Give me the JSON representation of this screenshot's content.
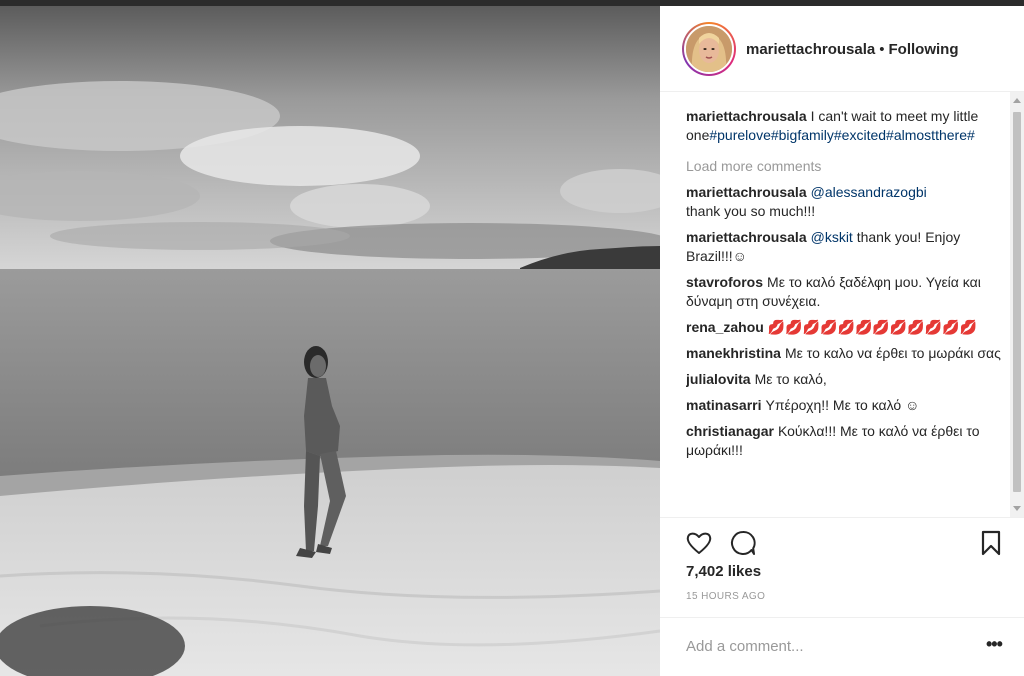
{
  "post": {
    "username": "mariettachrousala",
    "separator": "•",
    "follow_status": "Following",
    "caption": {
      "user": "mariettachrousala",
      "text": "I can't wait to meet my little one",
      "hashtags": [
        "#purelove",
        "#bigfamily",
        "#excited",
        "#almostthere",
        "#"
      ]
    },
    "load_more": "Load more comments",
    "comments": [
      {
        "user": "mariettachrousala",
        "mention": "@alessandrazogbi",
        "text": "thank you so much!!!"
      },
      {
        "user": "mariettachrousala",
        "mention": "@kskit",
        "text": "thank you! Enjoy Brazil!!!☺"
      },
      {
        "user": "stavroforos",
        "mention": "",
        "text": "Με το καλό ξαδέλφη μου. Υγεία και δύναμη στη συνέχεια."
      },
      {
        "user": "rena_zahou",
        "mention": "",
        "text": "💋💋💋💋💋💋💋💋💋💋💋💋"
      },
      {
        "user": "manekhristina",
        "mention": "",
        "text": "Με το καλο να έρθει το μωράκι σας"
      },
      {
        "user": "julialovita",
        "mention": "",
        "text": "Με το καλό,"
      },
      {
        "user": "matinasarri",
        "mention": "",
        "text": "Υπέροχη!! Με το καλό ☺"
      },
      {
        "user": "christianagar",
        "mention": "",
        "text": "Κούκλα!!! Με το καλό να έρθει το μωράκι!!!"
      }
    ],
    "likes": "7,402 likes",
    "time_ago": "15 HOURS AGO",
    "add_comment_placeholder": "Add a comment...",
    "more_options": "•••"
  },
  "icons": {
    "like": "heart-icon",
    "comment": "speech-bubble-icon",
    "save": "bookmark-icon"
  }
}
